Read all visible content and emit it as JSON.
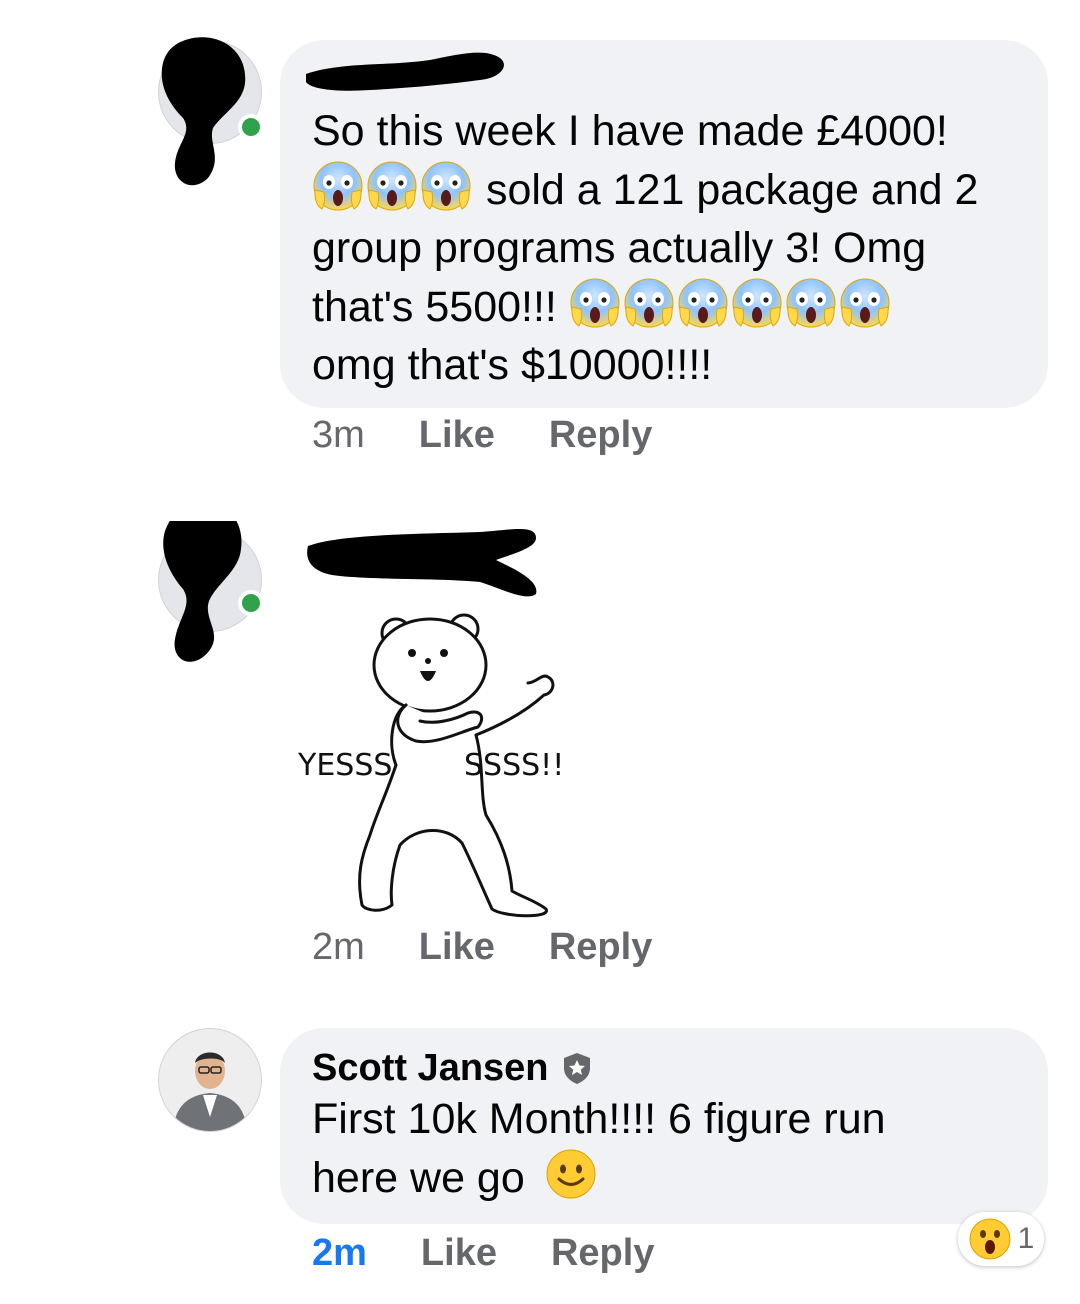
{
  "comments": [
    {
      "author": "",
      "text_line1": "So this week I have made £4000!",
      "text_line2": "sold a 121 package and 2",
      "text_line3": "group programs actually 3! Omg",
      "text_line4": "that's 5500!!!",
      "text_line5": "omg that's $10000!!!!",
      "emoji_group1": [
        "face-screaming-in-fear",
        "face-screaming-in-fear",
        "face-screaming-in-fear"
      ],
      "emoji_group2": [
        "face-screaming-in-fear",
        "face-screaming-in-fear",
        "face-screaming-in-fear",
        "face-screaming-in-fear",
        "face-screaming-in-fear",
        "face-screaming-in-fear"
      ],
      "time": "3m",
      "like_label": "Like",
      "reply_label": "Reply"
    },
    {
      "author": "",
      "sticker": {
        "name": "dancing-bear-sticker",
        "text_left": "YESSS",
        "text_right": "SSSS!!"
      },
      "time": "2m",
      "like_label": "Like",
      "reply_label": "Reply"
    },
    {
      "author": "Scott Jansen",
      "badge": "top-fan-shield-icon",
      "text_line1": "First 10k Month!!!! 6 figure run",
      "text_line2": "here we go",
      "emoji": "slightly-smiling-face",
      "time": "2m",
      "like_label": "Like",
      "reply_label": "Reply",
      "reaction": {
        "emoji": "face-with-open-mouth",
        "count": "1"
      }
    }
  ],
  "colors": {
    "bubble": "#f0f2f5",
    "meta_text": "#65676b",
    "recent_time": "#1877f2",
    "online": "#31a24c",
    "redaction": "#000000"
  }
}
